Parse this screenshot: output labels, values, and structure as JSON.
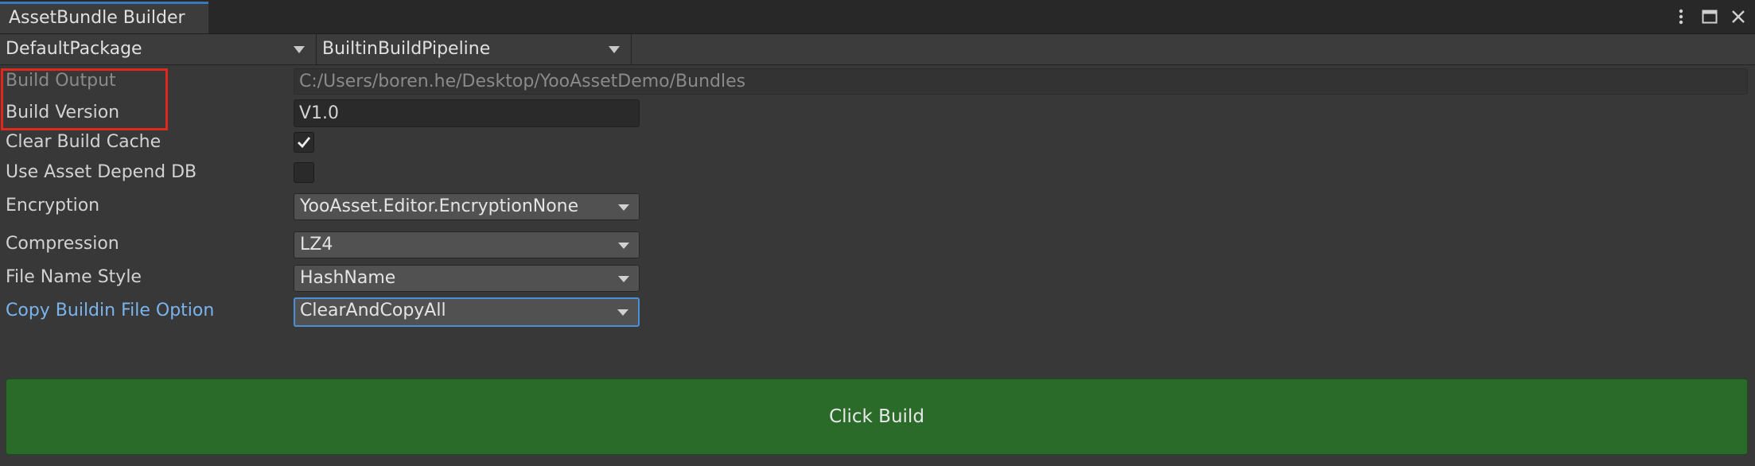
{
  "window": {
    "tab_title": "AssetBundle Builder"
  },
  "toolbar": {
    "package": "DefaultPackage",
    "pipeline": "BuiltinBuildPipeline"
  },
  "fields": {
    "build_output": {
      "label": "Build Output",
      "value": "C:/Users/boren.he/Desktop/YooAssetDemo/Bundles"
    },
    "build_version": {
      "label": "Build Version",
      "value": "V1.0"
    },
    "clear_build_cache": {
      "label": "Clear Build Cache",
      "checked": true
    },
    "use_asset_depend_db": {
      "label": "Use Asset Depend DB",
      "checked": false
    },
    "encryption": {
      "label": "Encryption",
      "value": "YooAsset.Editor.EncryptionNone"
    },
    "compression": {
      "label": "Compression",
      "value": "LZ4"
    },
    "file_name_style": {
      "label": "File Name Style",
      "value": "HashName"
    },
    "copy_buildin_file_option": {
      "label": "Copy Buildin File Option",
      "value": "ClearAndCopyAll"
    }
  },
  "build_button": {
    "label": "Click Build"
  },
  "colors": {
    "highlight": "#e0281e",
    "accent": "#7ab4ef",
    "build_button": "#2a6b2a"
  }
}
